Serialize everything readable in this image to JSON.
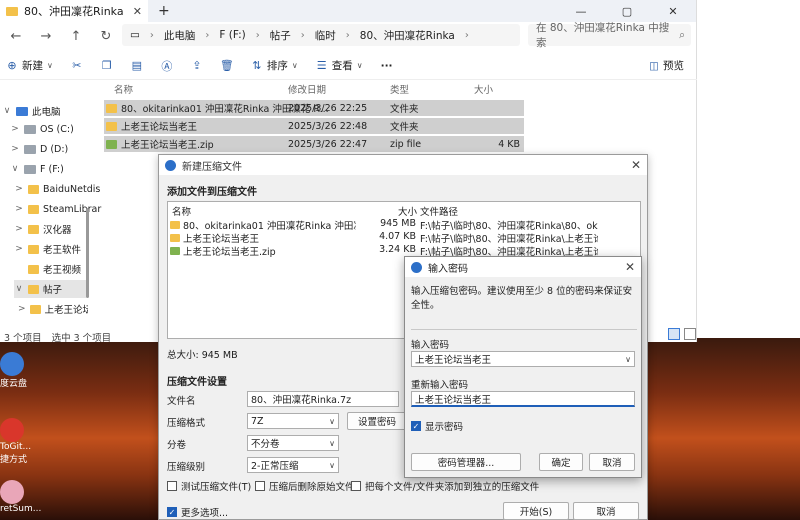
{
  "explorer": {
    "tab_title": "80、沖田凜花Rinka",
    "tab_close": "✕",
    "tab_add": "+",
    "window_buttons": [
      "—",
      "▢",
      "✕"
    ],
    "breadcrumbs": [
      "此电脑",
      "F (F:)",
      "帖子",
      "临时",
      "80、沖田凜花Rinka"
    ],
    "search_placeholder": "在 80、沖田凜花Rinka 中搜索",
    "toolbar": {
      "new_label": "新建",
      "sort_label": "排序",
      "view_label": "查看",
      "more_label": "···",
      "preview_label": "预览"
    },
    "columns": {
      "name": "名称",
      "date": "修改日期",
      "type": "类型",
      "size": "大小"
    },
    "files": [
      {
        "name": "80、okitarinka01 沖田凜花Rinka 沖田凜花 R...",
        "date": "2025/3/26 22:25",
        "type": "文件夹",
        "size": "",
        "kind": "folder"
      },
      {
        "name": "上老王论坛当老王",
        "date": "2025/3/26 22:48",
        "type": "文件夹",
        "size": "",
        "kind": "folder"
      },
      {
        "name": "上老王论坛当老王.zip",
        "date": "2025/3/26 22:47",
        "type": "zip file",
        "size": "4 KB",
        "kind": "zip"
      }
    ],
    "sidebar": [
      {
        "label": "此电脑",
        "kind": "pc",
        "chev": "∨"
      },
      {
        "label": "OS (C:)",
        "kind": "drive",
        "chev": ">"
      },
      {
        "label": "D (D:)",
        "kind": "drive",
        "chev": ">"
      },
      {
        "label": "F (F:)",
        "kind": "drive",
        "chev": "∨"
      },
      {
        "label": "BaiduNetdis",
        "kind": "folder",
        "chev": ">"
      },
      {
        "label": "SteamLibrar",
        "kind": "folder",
        "chev": ">"
      },
      {
        "label": "汉化器",
        "kind": "folder",
        "chev": ">"
      },
      {
        "label": "老王软件",
        "kind": "folder",
        "chev": ">"
      },
      {
        "label": "老王视频",
        "kind": "folder",
        "chev": ""
      },
      {
        "label": "帖子",
        "kind": "folder",
        "chev": "∨"
      },
      {
        "label": "上老王论坛当",
        "kind": "folder",
        "chev": ">"
      }
    ],
    "status_items": "3 个项目",
    "status_selected": "选中 3 个项目"
  },
  "desktop": {
    "icons": [
      {
        "label": "度云盘",
        "color": "#3a7bd5"
      },
      {
        "label": "ToGit... 捷方式",
        "color": "#d9362b"
      },
      {
        "label": "retSum...",
        "color": "#e9a6b8"
      }
    ]
  },
  "compress_dialog": {
    "title": "新建压缩文件",
    "close": "✕",
    "section_add": "添加文件到压缩文件",
    "list_headers": {
      "name": "名称",
      "size": "大小",
      "path": "文件路径"
    },
    "list_rows": [
      {
        "name": "80、okitarinka01 沖田凜花Rinka 沖田凜花 Ri...",
        "size": "945 MB",
        "path": "F:\\帖子\\临时\\80、沖田凜花Rinka\\80、okitarin...",
        "kind": "folder"
      },
      {
        "name": "上老王论坛当老王",
        "size": "4.07 KB",
        "path": "F:\\帖子\\临时\\80、沖田凜花Rinka\\上老王论坛当...",
        "kind": "folder"
      },
      {
        "name": "上老王论坛当老王.zip",
        "size": "3.24 KB",
        "path": "F:\\帖子\\临时\\80、沖田凜花Rinka\\上老王论坛当...",
        "kind": "zip"
      }
    ],
    "total_size": "总大小: 945 MB",
    "section_settings": "压缩文件设置",
    "filename_label": "文件名",
    "filename_value": "80、沖田凜花Rinka.7z",
    "format_label": "压缩格式",
    "format_value": "7Z",
    "split_label": "分卷",
    "split_value": "不分卷",
    "level_label": "压缩级别",
    "level_value": "2-正常压缩",
    "set_password_label": "设置密码",
    "test_label": "测试压缩文件(T)",
    "delete_label": "压缩后删除原始文件",
    "separate_label": "把每个文件/文件夹添加到独立的压缩文件",
    "more_options_label": "更多选项...",
    "start_label": "开始(S)",
    "cancel_label": "取消"
  },
  "password_dialog": {
    "title": "输入密码",
    "close": "✕",
    "description": "输入压缩包密码。建议使用至少 8 位的密码来保证安全性。",
    "password_label": "输入密码",
    "password_value": "上老王论坛当老王",
    "confirm_label": "重新输入密码",
    "confirm_value": "上老王论坛当老王",
    "show_password_label": "显示密码",
    "manager_label": "密码管理器...",
    "ok_label": "确定",
    "cancel_label": "取消"
  }
}
